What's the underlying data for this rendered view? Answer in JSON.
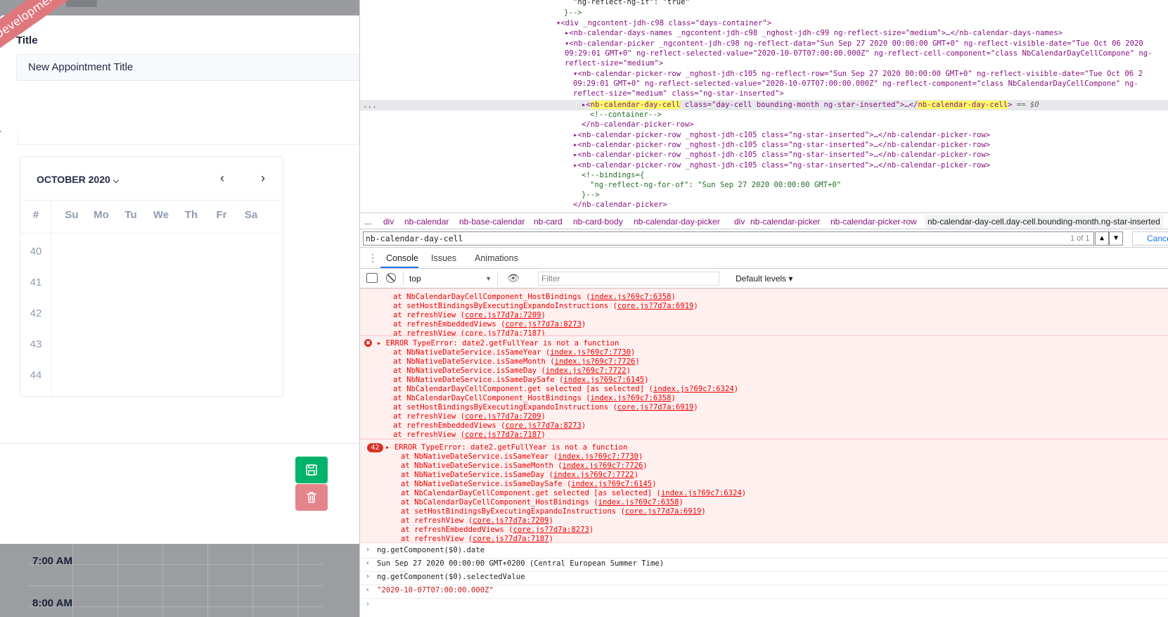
{
  "app": {
    "ribbon": "Development",
    "title_label": "Title",
    "title_value": "New Appointment Title",
    "calendar": {
      "month": "OCTOBER 2020",
      "week_header": "#",
      "day_names": [
        "Su",
        "Mo",
        "Tu",
        "We",
        "Th",
        "Fr",
        "Sa"
      ],
      "week_numbers": [
        "40",
        "41",
        "42",
        "43",
        "44"
      ]
    },
    "times": [
      "7:00 AM",
      "8:00 AM"
    ]
  },
  "devtools": {
    "elements": {
      "lines": [
        "\"ng-reflect-ng-if\": \"true\"",
        "}-->"
      ],
      "days_container": "<div _ngcontent-jdh-c98 class=\"days-container\">",
      "days_names": "<nb-calendar-days-names _ngcontent-jdh-c98 _nghost-jdh-c99 ng-reflect-size=\"medium\">…</nb-calendar-days-names>",
      "picker_1": "<nb-calendar-picker _ngcontent-jdh-c98 ng-reflect-data=\"Sun Sep 27 2020 00:00:00 GMT+0\" ng-reflect-visible-date=\"Tue Oct 06 2020",
      "picker_2": "09:29:01 GMT+0\" ng-reflect-selected-value=\"2020-10-07T07:00:00.000Z\" ng-reflect-cell-component=\"class NbCalendarDayCellCompone\" ng-",
      "picker_3": "reflect-size=\"medium\">",
      "row_1": "<nb-calendar-picker-row _nghost-jdh-c105 ng-reflect-row=\"Sun Sep 27 2020 00:00:00 GMT+0\" ng-reflect-visible-date=\"Tue Oct 06 2",
      "row_2": "09:29:01 GMT+0\" ng-reflect-selected-value=\"2020-10-07T07:00:00.000Z\" ng-reflect-component=\"class NbCalendarDayCellCompone\" ng-",
      "row_3": "reflect-size=\"medium\" class=\"ng-star-inserted\">",
      "selected_tag": "nb-calendar-day-cell",
      "selected_attrs": " class=\"day-cell bounding-month ng-star-inserted\">…</",
      "selected_suffix": " == $0",
      "container_comment": "<!--container-->",
      "close_row": "</nb-calendar-picker-row>",
      "collapsed_row": "<nb-calendar-picker-row _nghost-jdh-c105 class=\"ng-star-inserted\">…</nb-calendar-picker-row>",
      "bindings_1": "<!--bindings={",
      "bindings_2": "\"ng-reflect-ng-for-of\": \"Sun Sep 27 2020 00:00:00 GMT+0\"",
      "bindings_3": "}-->",
      "close_picker": "</nb-calendar-picker>",
      "gutter_dots": "..."
    },
    "breadcrumb": [
      "...",
      "div",
      "nb-calendar",
      "nb-base-calendar",
      "nb-card",
      "nb-card-body",
      "nb-calendar-day-picker",
      "div",
      "nb-calendar-picker",
      "nb-calendar-picker-row",
      "nb-calendar-day-cell.day-cell.bounding-month.ng-star-inserted"
    ],
    "search": {
      "value": "nb-calendar-day-cell",
      "count": "1 of 1",
      "cancel": "Cancel"
    },
    "tabs": [
      "Console",
      "Issues",
      "Animations"
    ],
    "console_toolbar": {
      "context": "top",
      "filter_placeholder": "Filter",
      "levels": "Default levels"
    },
    "console": {
      "first_partial": [
        "at NbCalendarDayCellComponent_HostBindings (|index.js?69c7:6358|)",
        "at setHostBindingsByExecutingExpandoInstructions (|core.js?7d7a:6919|)",
        "at refreshView (|core.js?7d7a:7209|)",
        "at refreshEmbeddedViews (|core.js?7d7a:8273|)",
        "at refreshView (|core.js?7d7a:7187|)"
      ],
      "error_title": "ERROR TypeError: date2.getFullYear is not a function",
      "stack": [
        "at NbNativeDateService.isSameYear (|index.js?69c7:7730|)",
        "at NbNativeDateService.isSameMonth (|index.js?69c7:7726|)",
        "at NbNativeDateService.isSameDay (|index.js?69c7:7722|)",
        "at NbNativeDateService.isSameDaySafe (|index.js?69c7:6145|)",
        "at NbCalendarDayCellComponent.get selected [as selected] (|index.js?69c7:6324|)",
        "at NbCalendarDayCellComponent_HostBindings (|index.js?69c7:6358|)",
        "at setHostBindingsByExecutingExpandoInstructions (|core.js?7d7a:6919|)",
        "at refreshView (|core.js?7d7a:7209|)",
        "at refreshEmbeddedViews (|core.js?7d7a:8273|)",
        "at refreshView (|core.js?7d7a:7187|)"
      ],
      "repeat_count": "42",
      "input_1": "ng.getComponent($0).date",
      "output_1": "Sun Sep 27 2020 00:00:00 GMT+0200 (Central European Summer Time)",
      "input_2": "ng.getComponent($0).selectedValue",
      "output_2": "\"2020-10-07T07:00:00.000Z\""
    }
  },
  "colors": {
    "save": "#00b36b",
    "delete": "#e4858c",
    "error_bg": "#fff0f0",
    "highlight": "#ffff66"
  }
}
